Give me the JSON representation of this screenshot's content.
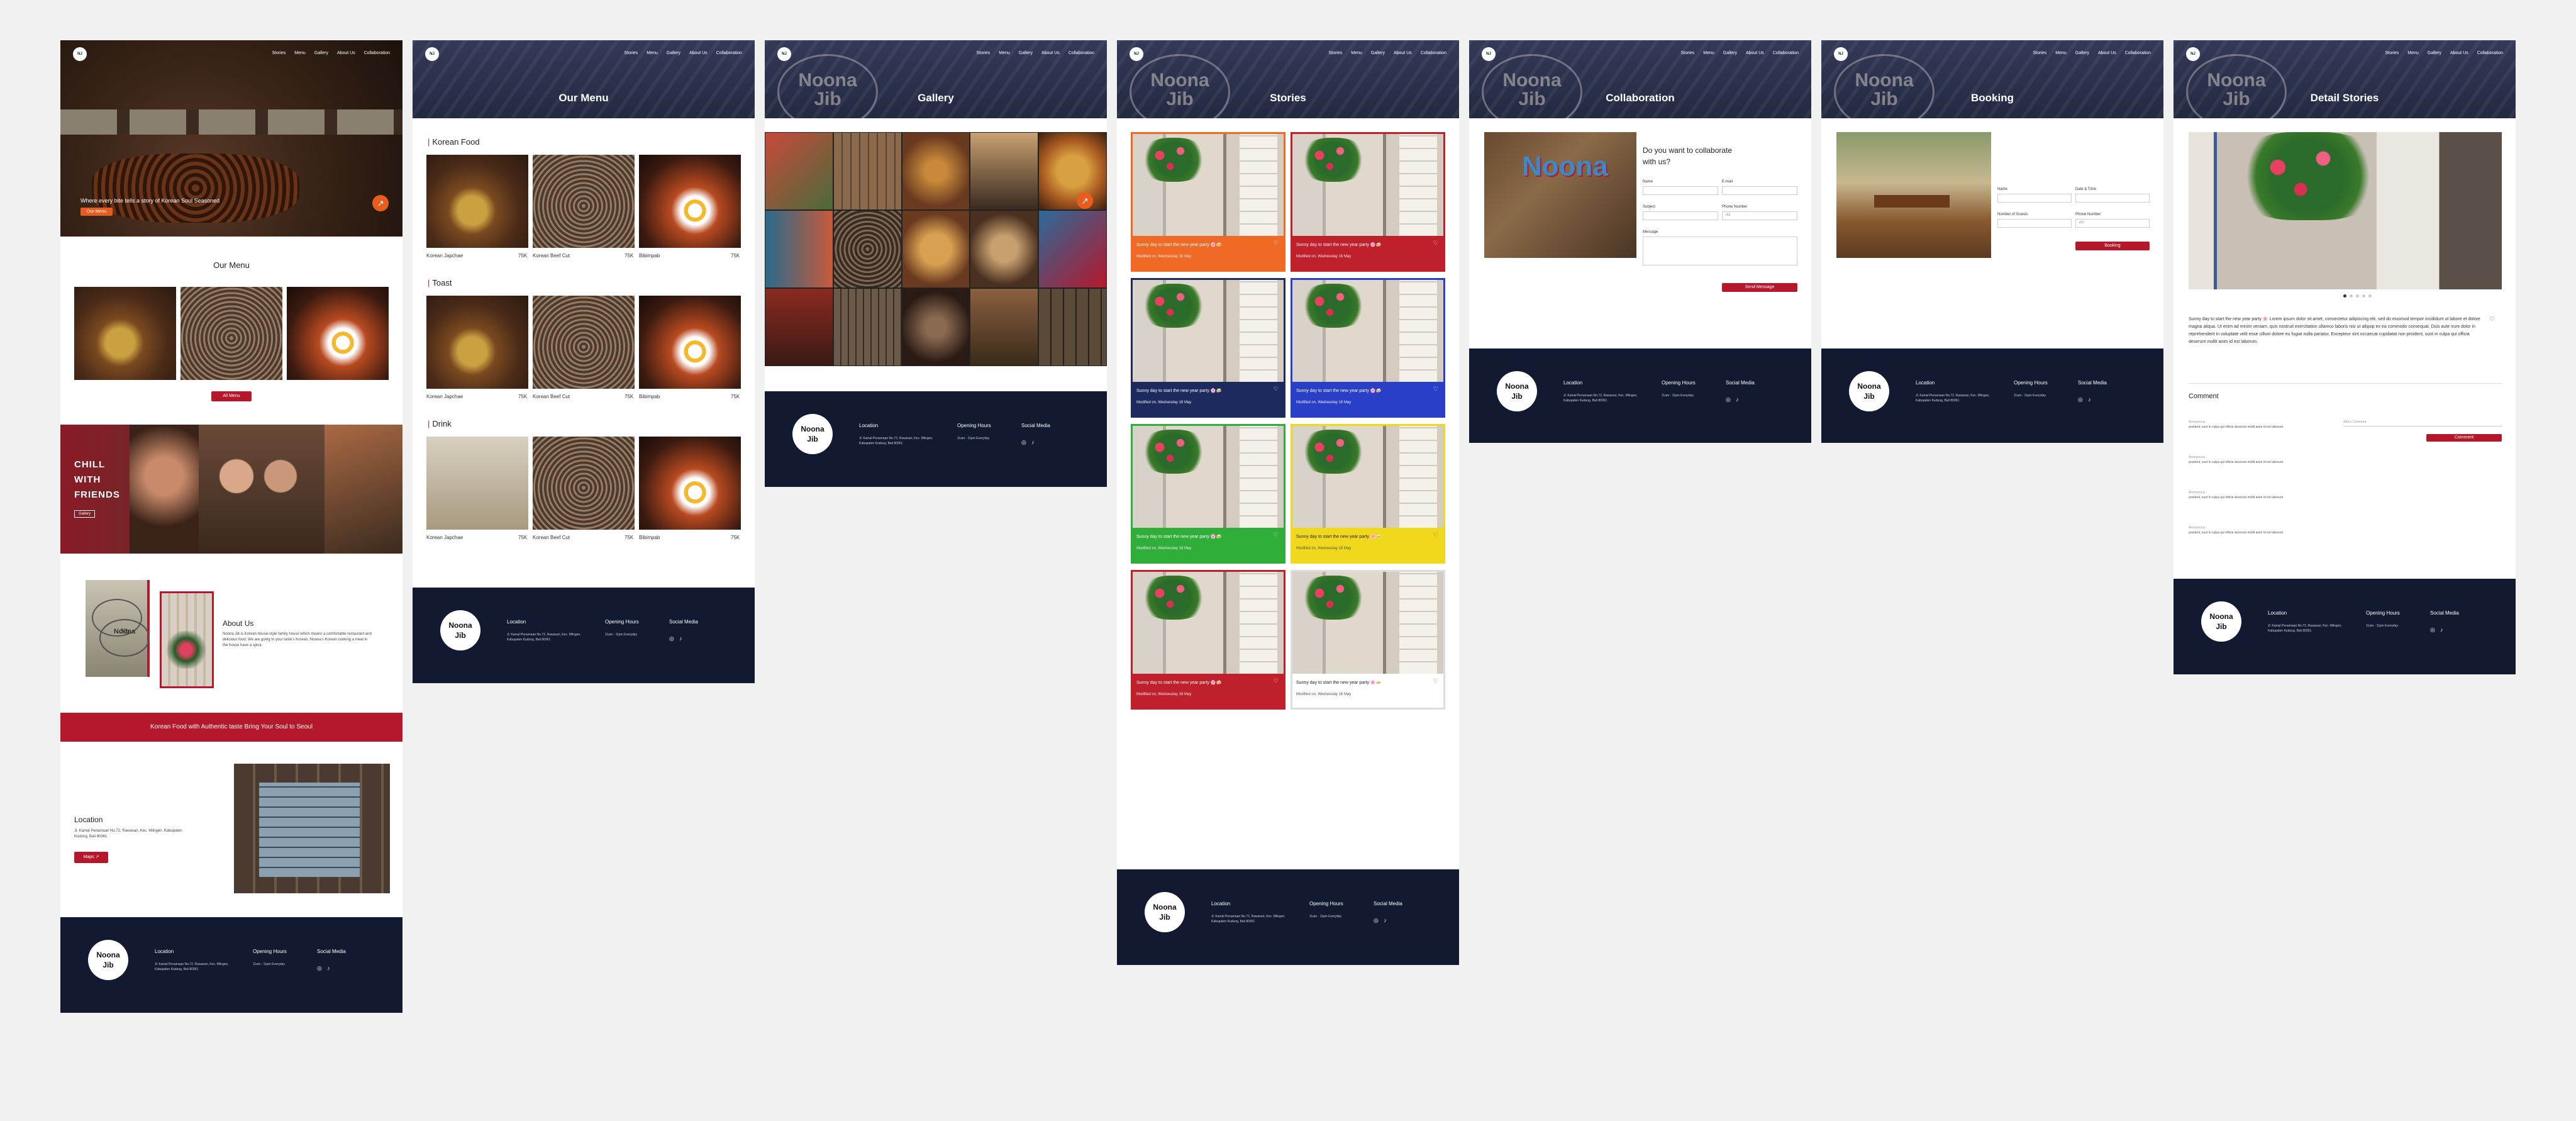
{
  "brand": {
    "logo_short": "NJ",
    "logo_line1": "Noona",
    "logo_line2": "Jib"
  },
  "nav": [
    "Stories",
    "Menu",
    "Gallery",
    "About Us",
    "Collaboration"
  ],
  "home": {
    "hero_tagline": "Where every bite tells a story of Korean Soul Seasoned",
    "hero_button": "Our Menu",
    "hero_arrow": "↗",
    "menu_title": "Our Menu",
    "menu_button": "All Menu",
    "chill_l1": "CHILL",
    "chill_l2": "WITH",
    "chill_l3": "FRIENDS",
    "chill_button": "Gallery",
    "about_title": "About Us",
    "about_text": "Noona Jib is Korean house-style family house which means a comfortable restaurant and delicious food. We are going to your taste’s Korean. Noona’s Korean cooking a meal in the house have a spice.",
    "banner": "Korean Food with Authentic taste Bring Your Soul to Seoul",
    "location_title": "Location",
    "location_text": "Jl. Kamal Penamaan No.72, Rawasari, Kec. Mlingen, Kabupaten Kudung, Bali 80361",
    "location_button": "Maps  ↗"
  },
  "footer": {
    "location_head": "Location",
    "location_text": "Jl. Kamal Penamaan No.72, Rawasari, Kec. Mlingen, Kabupaten Kudung, Bali 80361",
    "hours_head": "Opening Hours",
    "hours_text": "11am - 11pm Everyday",
    "social_head": "Social Media",
    "ig": "◎",
    "tt": "♪"
  },
  "menu_page": {
    "title": "Our Menu",
    "sections": [
      {
        "name": "Korean Food",
        "items": [
          {
            "name": "Korean Japchae",
            "price": "75K"
          },
          {
            "name": "Korean Beef Cut",
            "price": "75K"
          },
          {
            "name": "Bibimpab",
            "price": "75K"
          }
        ]
      },
      {
        "name": "Toast",
        "items": [
          {
            "name": "Korean Japchae",
            "price": "75K"
          },
          {
            "name": "Korean Beef Cut",
            "price": "75K"
          },
          {
            "name": "Bibimpab",
            "price": "75K"
          }
        ]
      },
      {
        "name": "Drink",
        "items": [
          {
            "name": "Korean Japchae",
            "price": "75K"
          },
          {
            "name": "Korean Beef Cut",
            "price": "75K"
          },
          {
            "name": "Bibimpab",
            "price": "75K"
          }
        ]
      }
    ]
  },
  "gallery_page": {
    "title": "Gallery",
    "arrow": "↗"
  },
  "stories_page": {
    "title": "Stories",
    "card_title": "Sunny day to start the new year party 🌸🍻",
    "card_sub": "Modified on, Wednesday 18 May",
    "heart": "♡",
    "card_colors": [
      "#f06a25",
      "#c01f2c",
      "#1c2a5e",
      "#2a3fc8",
      "#2fae3a",
      "#f0d81c",
      "#c01f2c",
      "#ffffff"
    ]
  },
  "collab_page": {
    "title": "Collaboration",
    "logo_text": "Noona",
    "heading_l1": "Do you want to collaborate",
    "heading_l2": "with us?",
    "name_label": "Name",
    "email_label": "E-mail",
    "subject_label": "Subject",
    "phone_label": "Phone Number",
    "phone_prefix": "+62",
    "message_label": "Message",
    "send_button": "Send Message"
  },
  "booking_page": {
    "title": "Booking",
    "name_label": "Name",
    "date_label": "Date & Time",
    "guests_label": "Number of Guests",
    "phone_label": "Phone Number",
    "phone_prefix": "+62",
    "book_button": "Booking"
  },
  "detail_page": {
    "title": "Detail Stories",
    "heading": "Sunny day to start the new year party 🌸",
    "body": "Sunny day to start the new year party 🌸 Lorem ipsum dolor sit amet, consectetur adipiscing elit, sed do eiusmod tempor incididunt ut labore et dolore magna aliqua. Ut enim ad minim veniam, quis nostrud exercitation ullamco laboris nisi ut aliquip ex ea commodo consequat. Duis aute irure dolor in reprehenderit in voluptate velit esse cillum dolore eu fugiat nulla pariatur. Excepteur sint occaecat cupidatat non proident, sunt in culpa qui officia deserunt mollit anim id est laborum.",
    "comment_title": "Comment",
    "comment_name": "Anonymous",
    "comment_text": "proident, sunt in culpa qui officia deserunt mollit anim id est laborum.",
    "comment_placeholder": "Add a Comment",
    "comment_button": "Comment"
  }
}
